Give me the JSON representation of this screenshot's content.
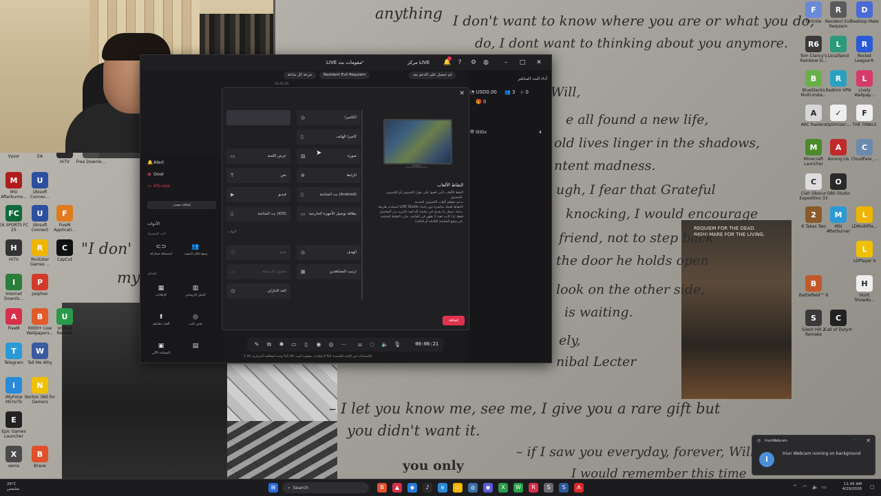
{
  "wallpaper": {
    "lines": [
      "anything",
      "I don't want to know where you are or what you do,",
      "do, I dont want to thinking about you anymore.",
      "Will,",
      "e all found a new life,",
      "old lives linger in the shadows,",
      "ntent madness.",
      "ugh, I fear that Grateful",
      "knocking, I would encourage",
      "friend, not to step back",
      "the door he holds open",
      "look on the other side,",
      "is waiting.",
      "ely,",
      "nibal Lecter",
      "\"I don'",
      "my",
      "– I let you know me, see me, I give you a rare gift but",
      "you didn't want it.",
      "– if I saw you everyday, forever, Will",
      "you only",
      "I would remember this time"
    ],
    "poster_text": "REQUIEM FOR THE DEAD. NIGHTMARE FOR THE LIVING."
  },
  "desktop_icons_left": [
    {
      "label": "Vysor",
      "color": "#3a6ea5",
      "glyph": "V"
    },
    {
      "label": "EA",
      "color": "#d6304a",
      "glyph": "EA"
    },
    {
      "label": "MSI Afterburne...",
      "color": "#b01c1c",
      "glyph": "M"
    },
    {
      "label": "Ubisoft Connec...",
      "color": "#2d4fa0",
      "glyph": "U"
    },
    {
      "label": "EA SPORTS FC 25",
      "color": "#0f6a3a",
      "glyph": "FC"
    },
    {
      "label": "Ubisoft Connect",
      "color": "#2d4fa0",
      "glyph": "U"
    },
    {
      "label": "FiveM Applicati...",
      "color": "#e07b20",
      "glyph": "F"
    },
    {
      "label": "HiTV",
      "color": "#333333",
      "glyph": "H"
    },
    {
      "label": "Rockstar Games ...",
      "color": "#f0b400",
      "glyph": "R"
    },
    {
      "label": "CapCut",
      "color": "#111111",
      "glyph": "C"
    },
    {
      "label": "Internet Downlo...",
      "color": "#2a7d3a",
      "glyph": "I"
    },
    {
      "label": "psiphon",
      "color": "#d23a2a",
      "glyph": "P"
    },
    {
      "label": "FiveM",
      "color": "#d6304a",
      "glyph": "A"
    },
    {
      "label": "6000+ Live Wallpapers...",
      "color": "#e05a2a",
      "glyph": "B"
    },
    {
      "label": "Unified Remote",
      "color": "#2a9a4a",
      "glyph": "U"
    },
    {
      "label": "Telegram",
      "color": "#2a9ad6",
      "glyph": "T"
    },
    {
      "label": "Tell Me Why",
      "color": "#3a5aa0",
      "glyph": "W"
    },
    {
      "label": "iMyFone MirrorTo",
      "color": "#2a8ad6",
      "glyph": "i"
    },
    {
      "label": "Norton 360 for Gamers",
      "color": "#f0c000",
      "glyph": "N"
    },
    {
      "label": "Epic Games Launcher",
      "color": "#222222",
      "glyph": "E"
    },
    {
      "label": "xenia",
      "color": "#4a4a4a",
      "glyph": "X"
    },
    {
      "label": "Brave",
      "color": "#e0502a",
      "glyph": "B"
    }
  ],
  "desktop_icons_right": [
    {
      "label": "Fortnite",
      "color": "#6a8ad6",
      "glyph": "F"
    },
    {
      "label": "Resident Evil Requiem",
      "color": "#5a5a5a",
      "glyph": "R"
    },
    {
      "label": "Desktop Mate",
      "color": "#4a6ad6",
      "glyph": "D"
    },
    {
      "label": "Tom Clancy's Rainbow Si...",
      "color": "#3a3a3a",
      "glyph": "R6"
    },
    {
      "label": "LocalSend",
      "color": "#2a9a7a",
      "glyph": "L"
    },
    {
      "label": "Rocket League®",
      "color": "#2a5ad6",
      "glyph": "R"
    },
    {
      "label": "BlueStacks Multi-Insta...",
      "color": "#6ab04a",
      "glyph": "B"
    },
    {
      "label": "Radmin VPN",
      "color": "#2aa0c0",
      "glyph": "R"
    },
    {
      "label": "Lively Wallpap...",
      "color": "#d63a6a",
      "glyph": "L"
    },
    {
      "label": "ARC Raiders",
      "color": "#d6d6d6",
      "glyph": "A"
    },
    {
      "label": "Optimizer-...",
      "color": "#eeeeee",
      "glyph": "✓"
    },
    {
      "label": "THE FINALS",
      "color": "#eeeeee",
      "glyph": "F"
    },
    {
      "label": "Minecraft Launcher",
      "color": "#4a8a2a",
      "glyph": "M"
    },
    {
      "label": "Among Us",
      "color": "#c02a2a",
      "glyph": "A"
    },
    {
      "label": "CloudFare_...",
      "color": "#6a8ab0",
      "glyph": "C"
    },
    {
      "label": "Clair Obscur Expedition 33",
      "color": "#dddddd",
      "glyph": "C"
    },
    {
      "label": "OBS Studio",
      "color": "#2a2a2a",
      "glyph": "O"
    },
    {
      "label": "It Takes Two",
      "color": "#8a5a2a",
      "glyph": "2"
    },
    {
      "label": "MSI Afterburner",
      "color": "#2a9ad6",
      "glyph": "M"
    },
    {
      "label": "LDMultiPla...",
      "color": "#f0b400",
      "glyph": "L"
    },
    {
      "label": "LDPlayer 9",
      "color": "#f0c000",
      "glyph": "L"
    },
    {
      "label": "Battlefield™ 6",
      "color": "#c05a2a",
      "glyph": "B"
    },
    {
      "label": "Hunt Showdo...",
      "color": "#eeeeee",
      "glyph": "H"
    },
    {
      "label": "Silent Hill 2 Remake",
      "color": "#3a3a3a",
      "glyph": "S"
    },
    {
      "label": "Call of Duty®",
      "color": "#222222",
      "glyph": "C"
    }
  ],
  "desktop_icons_mid": [
    {
      "label": "HiTV",
      "color": "#2a2a2a",
      "glyph": "H"
    },
    {
      "label": "Free Downlo...",
      "color": "#4a4a4a",
      "glyph": "F"
    }
  ],
  "app": {
    "title": "LIVE مقومات بث",
    "live_center": "مركز LIVE",
    "subbar": {
      "pill1": "جرعة كل ساعة",
      "pill2": "Resident Evil Requiem",
      "pill3": "لم تحصل على الدعم بعد"
    },
    "time_small": "02:45:33",
    "right_panel": {
      "title": "أداء البث المباشر",
      "usd": "USD0.00",
      "viewers": "3",
      "likes": "0",
      "gifts": "0",
      "user": "littlix",
      "user_count": "4"
    },
    "sidebar": {
      "alert": "Alert",
      "goal": "Goal",
      "file": "bfo.exe",
      "add_btn": "إضافة مصدر",
      "section": "الأدوات",
      "sub1": "البث المشترك",
      "tools1": [
        {
          "label": "استضافة مشاركة",
          "glyph": "⊂⊃"
        },
        {
          "label": "وضع اعلان الصوت",
          "glyph": "👥"
        }
      ],
      "sub2": "التفاعل",
      "tools2": [
        {
          "label": "الإعلانات",
          "glyph": "▦"
        },
        {
          "label": "الدليل الإرشادي",
          "glyph": "▥"
        },
        {
          "label": "ألعاب تفاعلية",
          "glyph": "⬆"
        },
        {
          "label": "هدف البث",
          "glyph": "◎"
        },
        {
          "label": "المساعد الآلي",
          "glyph": "▣"
        },
        {
          "label": "",
          "glyph": "▤"
        }
      ]
    },
    "timer": "00:06:21",
    "stats": "إحصاءات في الثانية الفاسدة: 0%   0 إطارات مفقودة   البث: 1.56%   وحدة المعالجة المركزية: 1.56%"
  },
  "modal": {
    "sources": [
      {
        "label": "الكاميرا",
        "glyph": "◎",
        "col": 1,
        "row": 0
      },
      {
        "label": "",
        "glyph": "",
        "col": 0,
        "row": 0,
        "selected": true
      },
      {
        "label": "كاميرا الهاتف",
        "glyph": "▯",
        "col": 1,
        "row": 1
      },
      {
        "label": "عرض اللعبة",
        "glyph": "▭",
        "col": 0,
        "row": 2
      },
      {
        "label": "صورة",
        "glyph": "▨",
        "col": 1,
        "row": 2
      },
      {
        "label": "نص",
        "glyph": "T",
        "col": 0,
        "row": 3
      },
      {
        "label": "الرابط",
        "glyph": "⊕",
        "col": 1,
        "row": 3
      },
      {
        "label": "فيديو",
        "glyph": "▶",
        "col": 0,
        "row": 4
      },
      {
        "label": "بث الشاشة (Android)",
        "glyph": "▯",
        "col": 1,
        "row": 4
      },
      {
        "label": "بث الشاشة (iOS)",
        "glyph": "▯",
        "col": 0,
        "row": 5
      },
      {
        "label": "بطاقة توصيل الأجهزة الخارجية",
        "glyph": "▭",
        "col": 1,
        "row": 5
      }
    ],
    "category": "أدوات",
    "sources2": [
      {
        "label": "تحية",
        "glyph": "☺",
        "col": 0,
        "row": 7,
        "disabled": true
      },
      {
        "label": "الهدف",
        "glyph": "◎",
        "col": 1,
        "row": 7
      },
      {
        "label": "محتوى الترجمة",
        "glyph": "▭",
        "col": 0,
        "row": 8,
        "disabled": true
      },
      {
        "label": "ترتيب المشاهدين",
        "glyph": "▦",
        "col": 1,
        "row": 8
      },
      {
        "label": "العد التنازلي",
        "glyph": "◷",
        "col": 0,
        "row": 9
      }
    ],
    "preview_title": "التقاط الألعاب",
    "preview_desc": [
      "التقط الألعاب التي تلعبها على جهاز الكمبيوتر أو الكمبيوتر",
      "المحمول.",
      "يدعم معظم ألعاب الكمبيوتر الحديثة",
      "استخدم طريقة LIVE Studio لالتقاط لعبتك مباشرة دون إعداد",
      "بديلة. سجل ما يجري في شاشة أي لعبة بالمزيد من التفاصيل.",
      "فقط، إذا كانت لعبة لا تظهر في القائمة، جرّب التقاط الشاشة",
      "في وضع الشاشة الكاملة أو النافذة."
    ],
    "add_label": "إضافة"
  },
  "taskbar": {
    "weather_temp": "26°C",
    "weather_desc": "مشمس",
    "search": "Search",
    "time": "11:45 AM",
    "date": "4/29/2026",
    "apps": [
      {
        "color": "#e0502a",
        "glyph": "B"
      },
      {
        "color": "#d6304a",
        "glyph": "▲"
      },
      {
        "color": "#2a7ad6",
        "glyph": "◆"
      },
      {
        "color": "#2a2a2a",
        "glyph": "♪"
      },
      {
        "color": "#2a8ad6",
        "glyph": "e"
      },
      {
        "color": "#f0b400",
        "glyph": "▭"
      },
      {
        "color": "#3a6ea5",
        "glyph": "◎"
      },
      {
        "color": "#5a5ad6",
        "glyph": "◉"
      },
      {
        "color": "#2a9a4a",
        "glyph": "X"
      },
      {
        "color": "#25a244",
        "glyph": "W"
      },
      {
        "color": "#d6304a",
        "glyph": "R"
      },
      {
        "color": "#6a6a6a",
        "glyph": "S"
      },
      {
        "color": "#2a5a9a",
        "glyph": "S"
      },
      {
        "color": "#d62a2a",
        "glyph": "ᗑ"
      }
    ]
  },
  "toast": {
    "app": "IriunWebcam",
    "message": "Iriun Webcam running on background"
  }
}
